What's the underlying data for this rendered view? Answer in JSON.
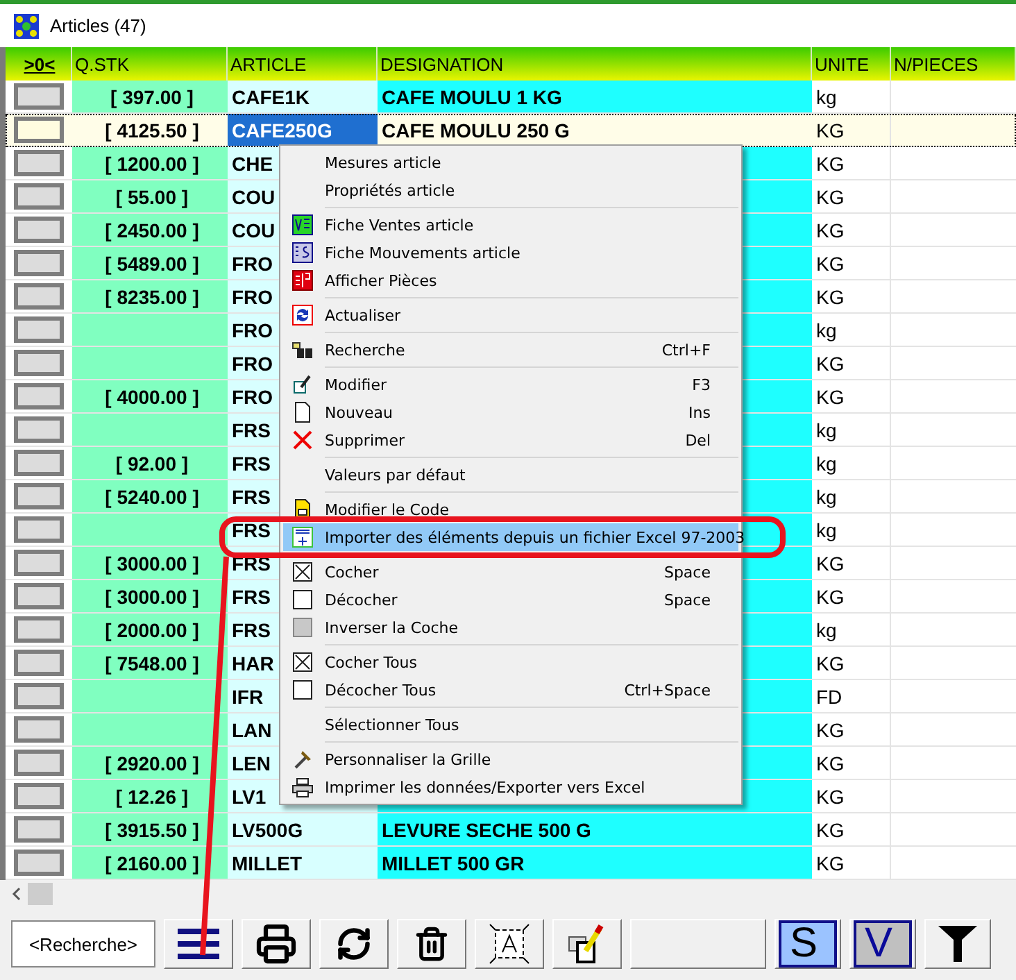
{
  "window": {
    "title": "Articles (47)"
  },
  "table": {
    "columns": [
      ">0<",
      "Q.STK",
      "ARTICLE",
      "DESIGNATION",
      "UNITE",
      "N/PIECES"
    ],
    "rows": [
      {
        "selected": false,
        "qty": "[ 397.00 ]",
        "article": "CAFE1K",
        "designation": "CAFE MOULU 1 KG",
        "unit": "kg"
      },
      {
        "selected": true,
        "qty": "[ 4125.50 ]",
        "article": "CAFE250G",
        "designation": "CAFE MOULU 250 G",
        "unit": "KG"
      },
      {
        "selected": false,
        "qty": "[ 1200.00 ]",
        "article": "CHE",
        "unit": "KG"
      },
      {
        "selected": false,
        "qty": "[ 55.00 ]",
        "article": "COU",
        "unit": "KG"
      },
      {
        "selected": false,
        "qty": "[ 2450.00 ]",
        "article": "COU",
        "unit": "KG"
      },
      {
        "selected": false,
        "qty": "[ 5489.00 ]",
        "article": "FRO",
        "unit": "KG"
      },
      {
        "selected": false,
        "qty": "[ 8235.00 ]",
        "article": "FRO",
        "unit": "KG"
      },
      {
        "selected": false,
        "article": "FRO",
        "unit": "kg"
      },
      {
        "selected": false,
        "article": "FRO",
        "unit": "KG"
      },
      {
        "selected": false,
        "qty": "[ 4000.00 ]",
        "article": "FRO",
        "unit": "KG"
      },
      {
        "selected": false,
        "article": "FRS",
        "unit": "kg"
      },
      {
        "selected": false,
        "qty": "[ 92.00 ]",
        "article": "FRS",
        "unit": "kg"
      },
      {
        "selected": false,
        "qty": "[ 5240.00 ]",
        "article": "FRS",
        "unit": "kg"
      },
      {
        "selected": false,
        "article": "FRS",
        "unit": "kg"
      },
      {
        "selected": false,
        "qty": "[ 3000.00 ]",
        "article": "FRS",
        "unit": "KG"
      },
      {
        "selected": false,
        "qty": "[ 3000.00 ]",
        "article": "FRS",
        "unit": "KG"
      },
      {
        "selected": false,
        "qty": "[ 2000.00 ]",
        "article": "FRS",
        "unit": "kg"
      },
      {
        "selected": false,
        "qty": "[ 7548.00 ]",
        "article": "HAR",
        "unit": "KG"
      },
      {
        "selected": false,
        "article": "IFR",
        "unit": "FD"
      },
      {
        "selected": false,
        "article": "LAN",
        "unit": "KG"
      },
      {
        "selected": false,
        "qty": "[ 2920.00 ]",
        "article": "LEN",
        "unit": "KG"
      },
      {
        "selected": false,
        "qty": "[ 12.26 ]",
        "article": "LV1",
        "unit": "KG"
      },
      {
        "selected": false,
        "qty": "[ 3915.50 ]",
        "article": "LV500G",
        "designation": "LEVURE SECHE 500 G",
        "unit": "KG"
      },
      {
        "selected": false,
        "qty": "[ 2160.00 ]",
        "article": "MILLET",
        "designation": "MILLET 500 GR",
        "unit": "KG"
      }
    ]
  },
  "menu": {
    "groups": [
      [
        {
          "label": "Mesures article",
          "selected": false
        },
        {
          "label": "Propriétés article",
          "selected": false
        }
      ],
      [
        {
          "label": "Fiche Ventes article",
          "selected": false
        },
        {
          "label": "Fiche Mouvements article",
          "selected": false
        },
        {
          "label": "Afficher Pièces",
          "selected": false
        }
      ],
      [
        {
          "label": "Actualiser",
          "selected": false
        }
      ],
      [
        {
          "label": "Recherche",
          "shortcut": "Ctrl+F",
          "selected": false
        }
      ],
      [
        {
          "label": "Modifier",
          "shortcut": "F3",
          "selected": false
        },
        {
          "label": "Nouveau",
          "shortcut": "Ins",
          "selected": false
        },
        {
          "label": "Supprimer",
          "shortcut": "Del",
          "selected": false
        }
      ],
      [
        {
          "label": "Valeurs par défaut",
          "selected": false
        }
      ],
      [
        {
          "label": "Modifier le Code",
          "selected": false
        },
        {
          "label": "Importer des éléments depuis un fichier Excel 97-2003",
          "selected": true
        }
      ],
      [
        {
          "label": "Cocher",
          "shortcut": "Space",
          "selected": false
        },
        {
          "label": "Décocher",
          "shortcut": "Space",
          "selected": false
        },
        {
          "label": "Inverser la Coche",
          "selected": false
        }
      ],
      [
        {
          "label": "Cocher Tous",
          "selected": false
        },
        {
          "label": "Décocher Tous",
          "shortcut": "Ctrl+Space",
          "selected": false
        }
      ],
      [
        {
          "label": "Sélectionner Tous",
          "selected": false
        }
      ],
      [
        {
          "label": "Personnaliser la Grille",
          "selected": false
        },
        {
          "label": "Imprimer les données/Exporter vers Excel",
          "selected": false
        }
      ]
    ]
  },
  "toolbar": {
    "search": {
      "value": "<Recherche>"
    },
    "buttons": [
      {
        "kind": "menu"
      },
      {
        "kind": "print"
      },
      {
        "kind": "refresh"
      },
      {
        "kind": "delete"
      },
      {
        "kind": "select"
      },
      {
        "kind": "edit"
      },
      {
        "kind": "blank"
      },
      {
        "kind": "letter",
        "label": "S"
      },
      {
        "kind": "letter",
        "label": "V"
      },
      {
        "kind": "filter"
      }
    ]
  }
}
